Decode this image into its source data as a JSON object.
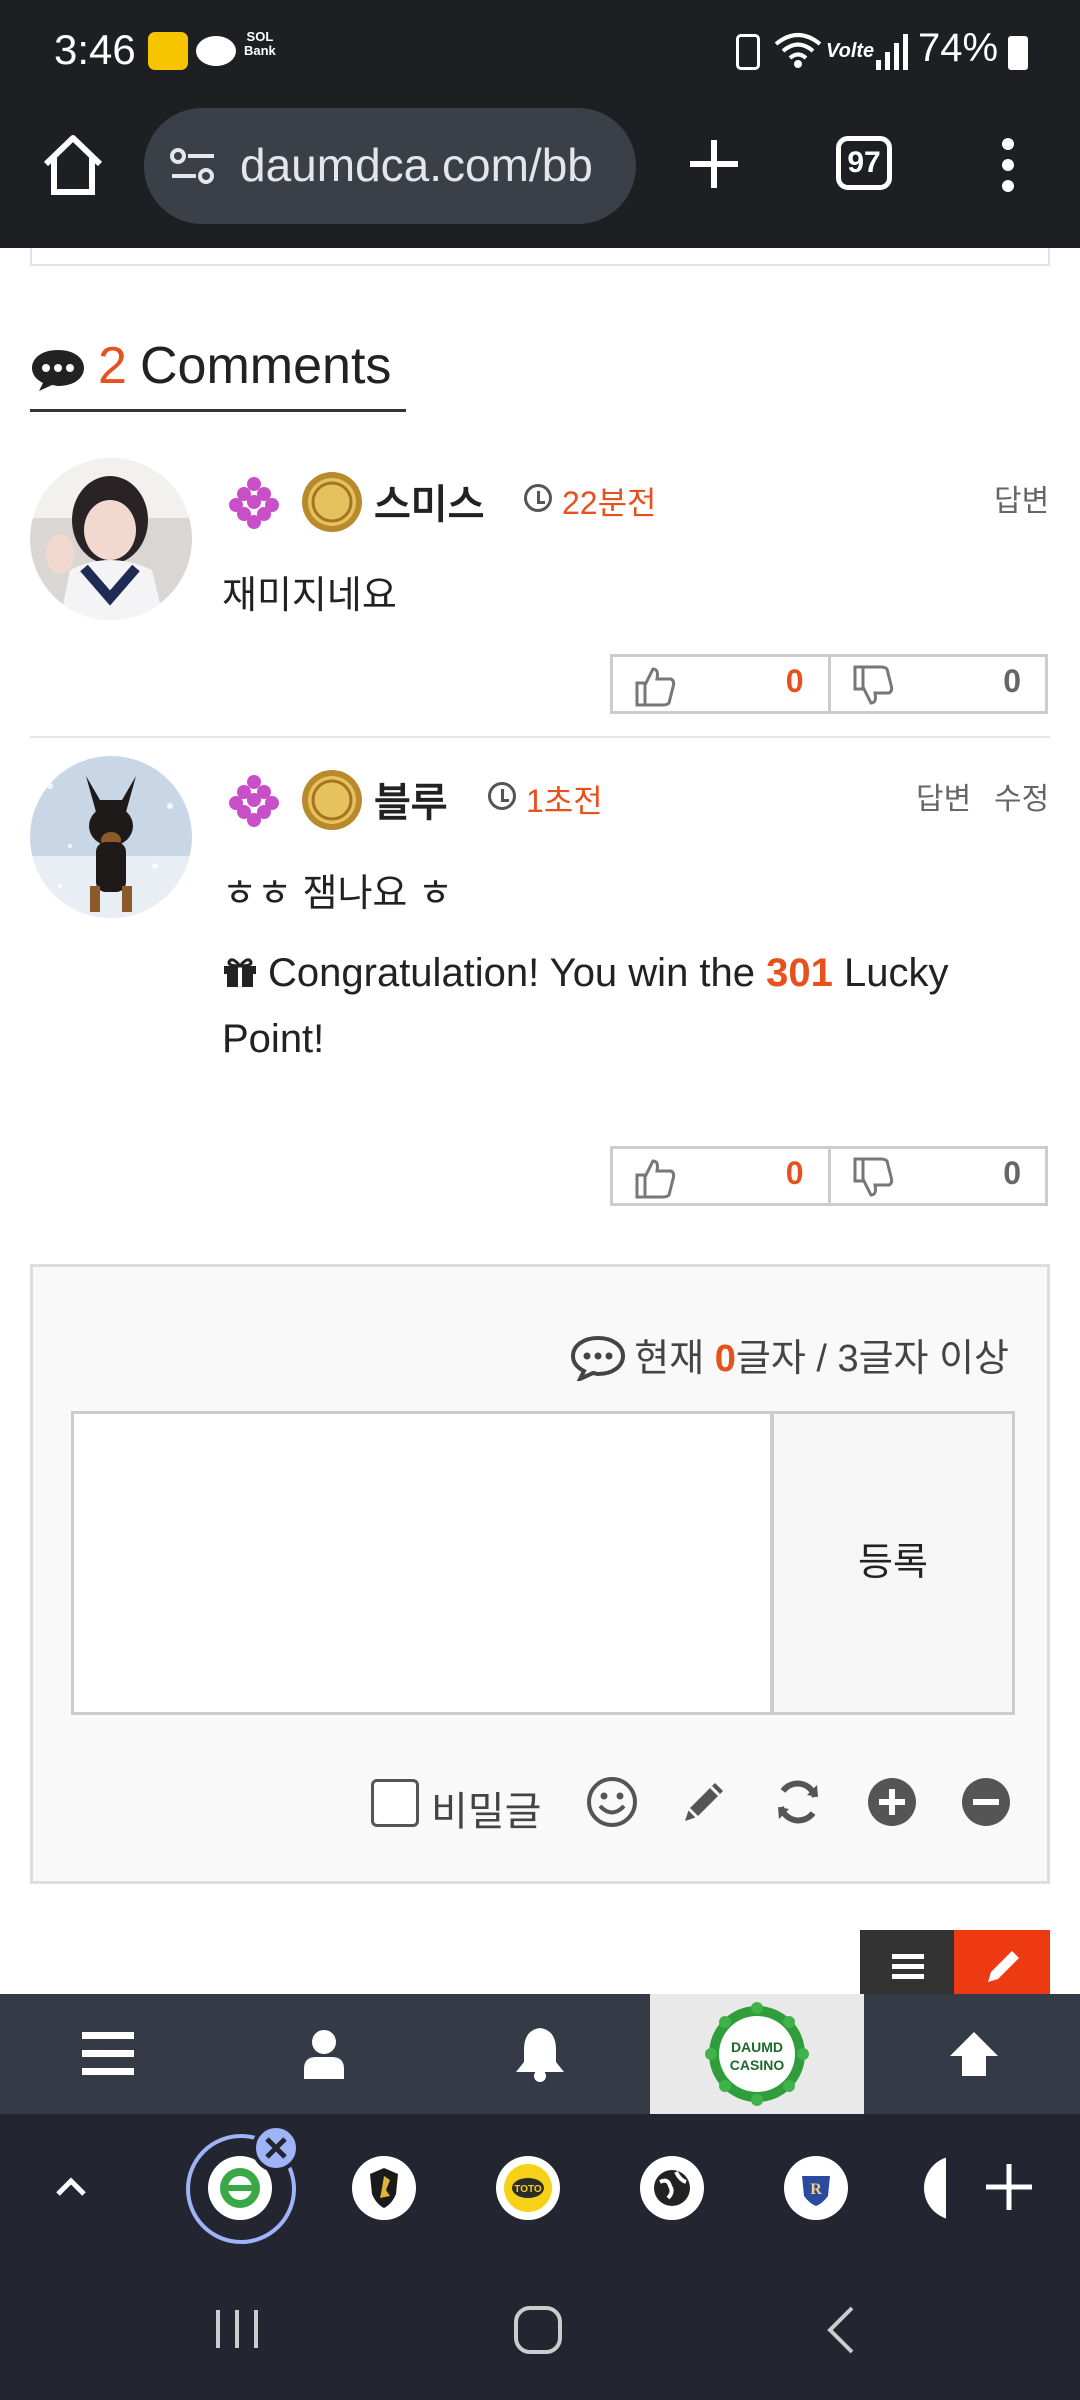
{
  "status_bar": {
    "time": "3:46",
    "sol_label": "SOL",
    "bank_label": "Bank",
    "volte": "Volte",
    "battery": "74%"
  },
  "browser": {
    "url": "daumdca.com/bb",
    "tab_count": "97"
  },
  "comments_header": {
    "count": "2",
    "label": "Comments"
  },
  "comments": [
    {
      "author": "스미스",
      "time": "22분전",
      "actions": [
        "답변"
      ],
      "body": "재미지네요",
      "upvotes": "0",
      "downvotes": "0"
    },
    {
      "author": "블루",
      "time": "1초전",
      "actions": [
        "답변",
        "수정"
      ],
      "body": "ㅎㅎ 잼나요 ㅎ",
      "lucky_prefix": "Congratulation! You win the",
      "lucky_points": "301",
      "lucky_suffix": "Lucky Point!",
      "upvotes": "0",
      "downvotes": "0"
    }
  ],
  "comment_form": {
    "length_prefix": "현재",
    "length_value": "0",
    "length_suffix": "글자 / 3글자 이상",
    "textarea_value": "",
    "submit_label": "등록",
    "secret_label": "비밀글"
  },
  "site_nav": {
    "logo_text": "DAUMD CASINO"
  },
  "colors": {
    "accent": "#e8501e",
    "nav_bg": "#343b47",
    "fab_write": "#ee3a12"
  },
  "icons": [
    "home-icon",
    "site-settings-icon",
    "new-tab-icon",
    "more-menu-icon",
    "chat-bubble-icon",
    "clock-icon",
    "thumbs-up-icon",
    "thumbs-down-icon",
    "gift-icon",
    "smile-icon",
    "pencil-icon",
    "refresh-icon",
    "plus-circle-icon",
    "minus-circle-icon",
    "hamburger-icon",
    "user-icon",
    "bell-icon",
    "arrow-up-icon"
  ]
}
